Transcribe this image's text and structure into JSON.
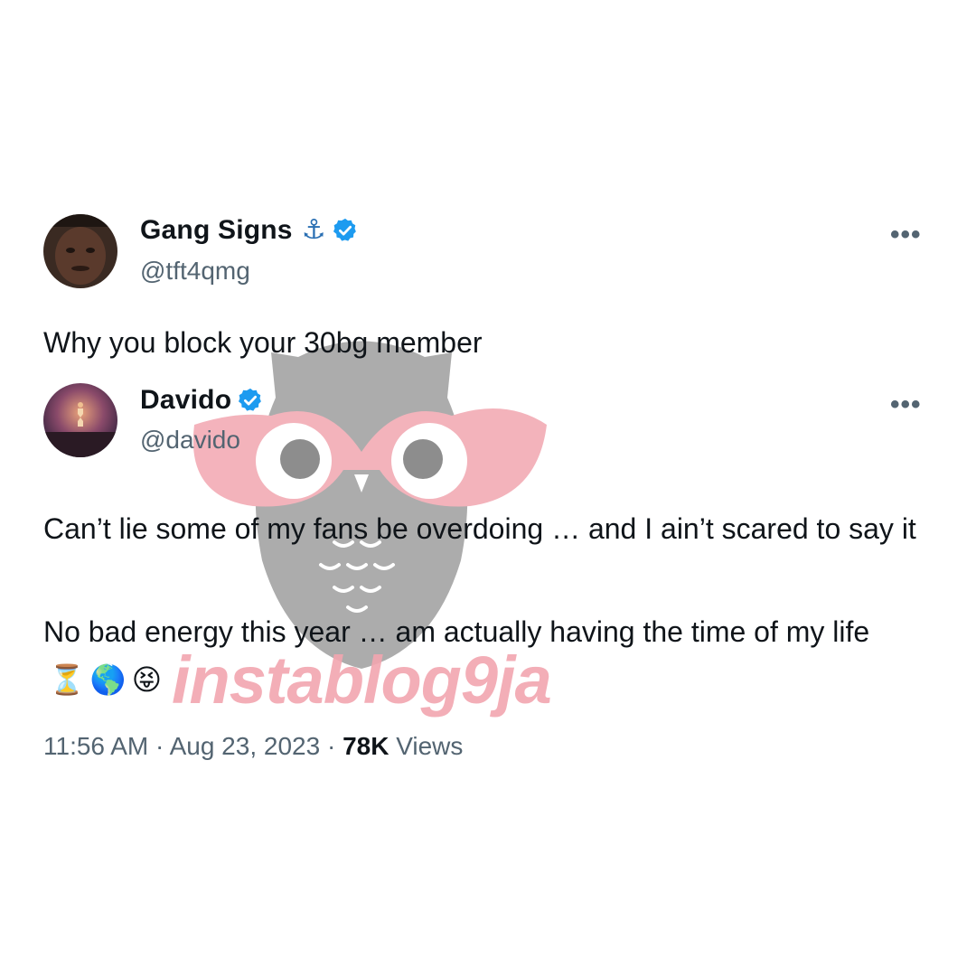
{
  "quoted_tweet": {
    "display_name": "Gang Signs",
    "name_emoji": "⚓",
    "handle": "@tft4qmg",
    "text": "Why you block your 30bg member",
    "more_label": "•••"
  },
  "main_tweet": {
    "display_name": "Davido",
    "handle": "@davido",
    "paragraph_1": "Can’t lie some of my fans be overdoing … and I ain’t scared to say it",
    "paragraph_2": "No bad energy this year … am actually having the time of my life",
    "emojis": [
      "⏳",
      "🌎",
      "😝"
    ],
    "more_label": "•••",
    "time": "11:56 AM",
    "separator": "·",
    "date": "Aug 23, 2023",
    "views_count": "78K",
    "views_label": "Views"
  },
  "watermark": {
    "text": "instablog9ja",
    "color": "#f2a6b0",
    "owl_color": "#8c8c8c"
  },
  "colors": {
    "verified_blue": "#1d9bf0",
    "secondary_text": "#536471",
    "primary_text": "#0f1419"
  }
}
